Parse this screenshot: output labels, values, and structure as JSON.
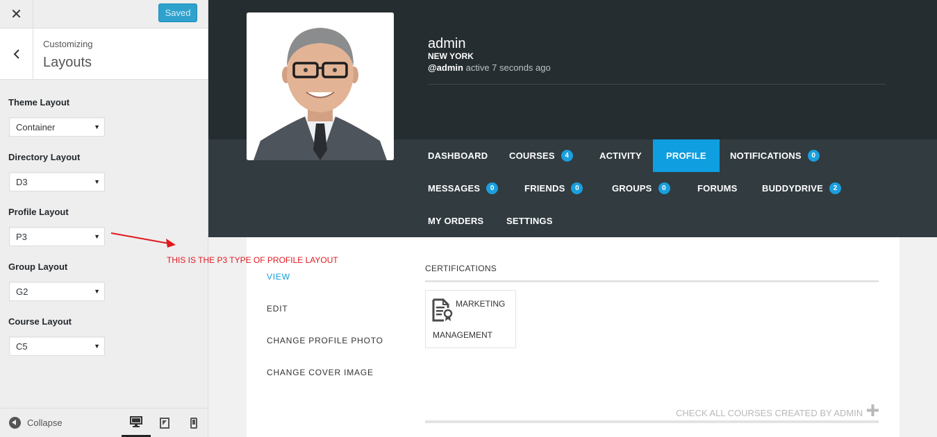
{
  "customizer": {
    "close_label": "✕",
    "saved_label": "Saved",
    "breadcrumb": "Customizing",
    "section_title": "Layouts",
    "controls": [
      {
        "label": "Theme Layout",
        "value": "Container"
      },
      {
        "label": "Directory Layout",
        "value": "D3"
      },
      {
        "label": "Profile Layout",
        "value": "P3"
      },
      {
        "label": "Group Layout",
        "value": "G2"
      },
      {
        "label": "Course Layout",
        "value": "C5"
      }
    ],
    "collapse_label": "Collapse",
    "devices": [
      "desktop-icon",
      "tablet-icon",
      "mobile-icon"
    ],
    "accent": "#2ea2cc"
  },
  "profile": {
    "name": "admin",
    "location": "NEW YORK",
    "handle": "@admin",
    "activity": "active 7 seconds ago"
  },
  "nav": {
    "row1": [
      {
        "label": "DASHBOARD"
      },
      {
        "label": "COURSES",
        "count": "4"
      },
      {
        "label": "ACTIVITY"
      },
      {
        "label": "PROFILE",
        "active": true
      },
      {
        "label": "NOTIFICATIONS",
        "count": "0"
      }
    ],
    "row2": [
      {
        "label": "MESSAGES",
        "count": "0"
      },
      {
        "label": "FRIENDS",
        "count": "0"
      },
      {
        "label": "GROUPS",
        "count": "0"
      },
      {
        "label": "FORUMS"
      },
      {
        "label": "BUDDYDRIVE",
        "count": "2"
      }
    ],
    "row3": [
      {
        "label": "MY ORDERS"
      },
      {
        "label": "SETTINGS"
      }
    ],
    "active_color": "#0f9ee0"
  },
  "subnav": [
    {
      "label": "VIEW",
      "current": true
    },
    {
      "label": "EDIT"
    },
    {
      "label": "CHANGE PROFILE PHOTO"
    },
    {
      "label": "CHANGE COVER IMAGE"
    }
  ],
  "certifications": {
    "title": "CERTIFICATIONS",
    "items": [
      {
        "line1": "MARKETING",
        "line2": "MANAGEMENT",
        "icon": "certificate-icon"
      }
    ],
    "check_all_label": "CHECK ALL COURSES CREATED BY ADMIN"
  },
  "annotation": {
    "text": "THIS IS THE P3 TYPE OF PROFILE LAYOUT",
    "color": "#e0191f"
  }
}
